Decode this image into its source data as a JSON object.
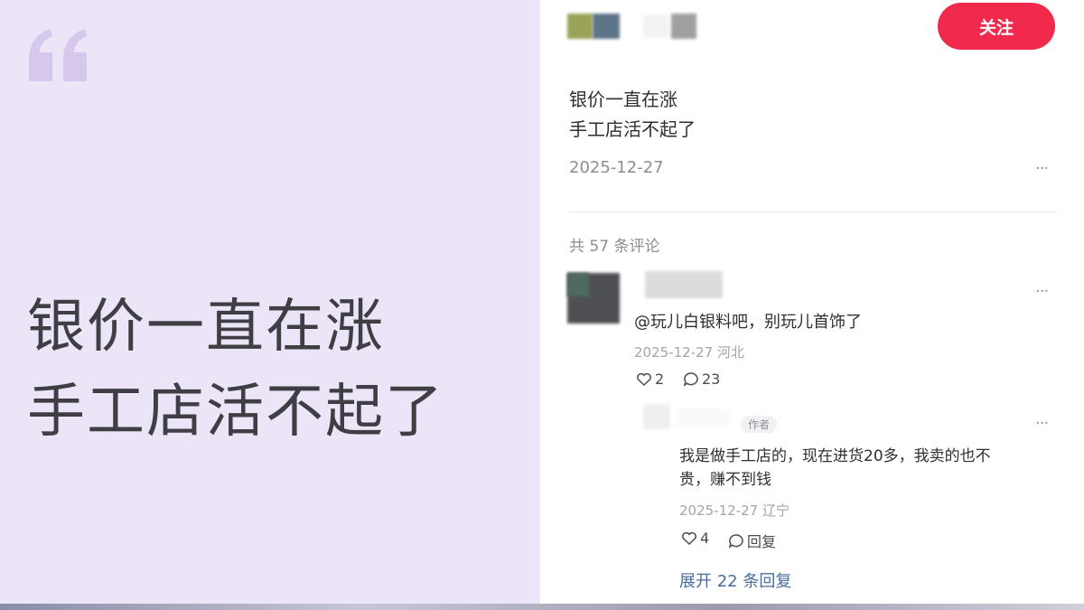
{
  "left": {
    "line1": "银价一直在涨",
    "line2": "手工店活不起了",
    "accent_color": "#ece5f7",
    "quote_color": "#d6c7ec"
  },
  "post": {
    "follow_label": "关注",
    "follow_color": "#f1294d",
    "text_line1": "银价一直在涨",
    "text_line2": "手工店活不起了",
    "date": "2025-12-27",
    "more_icon": "···"
  },
  "comments": {
    "count_text": "共 57 条评论",
    "first": {
      "text": "@玩儿白银料吧，别玩儿首饰了",
      "meta": "2025-12-27 河北",
      "likes": "2",
      "replies": "23"
    },
    "reply": {
      "badge": "作者",
      "line1": "我是做手工店的，现在进货20多，我卖的也不",
      "line2": "贵，赚不到钱",
      "meta": "2025-12-27 辽宁",
      "likes": "4",
      "reply_label": "回复"
    },
    "expand_label": "展开 22 条回复"
  }
}
